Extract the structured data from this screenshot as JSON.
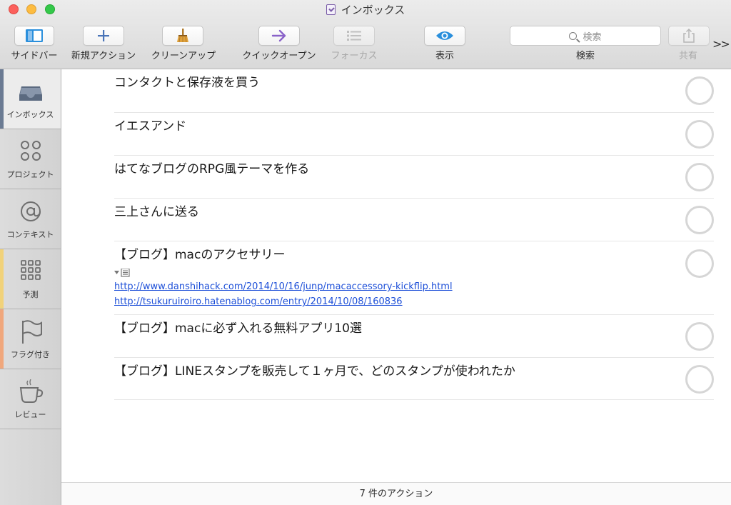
{
  "window": {
    "title": "インボックス"
  },
  "toolbar": {
    "sidebar_label": "サイドバー",
    "new_action_label": "新規アクション",
    "cleanup_label": "クリーンアップ",
    "quick_open_label": "クイックオープン",
    "focus_label": "フォーカス",
    "view_label": "表示",
    "search_label": "検索",
    "search_placeholder": "検索",
    "share_label": "共有",
    "overflow_label": ">>"
  },
  "sidebar": {
    "items": [
      {
        "label": "インボックス",
        "icon": "inbox-icon",
        "active": true
      },
      {
        "label": "プロジェクト",
        "icon": "projects-icon"
      },
      {
        "label": "コンテキスト",
        "icon": "at-sign-icon"
      },
      {
        "label": "予測",
        "icon": "forecast-grid-icon",
        "accent": "#f1d27a"
      },
      {
        "label": "フラグ付き",
        "icon": "flag-icon",
        "accent": "#f0a77c"
      },
      {
        "label": "レビュー",
        "icon": "coffee-cup-icon"
      }
    ]
  },
  "actions": [
    {
      "title": "コンタクトと保存液を買う"
    },
    {
      "title": "イエスアンド"
    },
    {
      "title": "はてなブログのRPG風テーマを作る"
    },
    {
      "title": "三上さんに送る"
    },
    {
      "title": "【ブログ】macのアクセサリー",
      "links": [
        "http://www.danshihack.com/2014/10/16/junp/macaccessory-kickflip.html",
        "http://tsukuruiroiro.hatenablog.com/entry/2014/10/08/160836"
      ]
    },
    {
      "title": "【ブログ】macに必ず入れる無料アプリ10選"
    },
    {
      "title": "【ブログ】LINEスタンプを販売して１ヶ月で、どのスタンプが使われたか"
    }
  ],
  "footer": {
    "count_text": "7 件のアクション"
  },
  "colors": {
    "link": "#1d4fd8",
    "quick_open_accent": "#8a63c9",
    "view_accent": "#2a8fdc",
    "cleanup_accent": "#e0a13a",
    "sidebar_accent": "#2a8fdc"
  }
}
